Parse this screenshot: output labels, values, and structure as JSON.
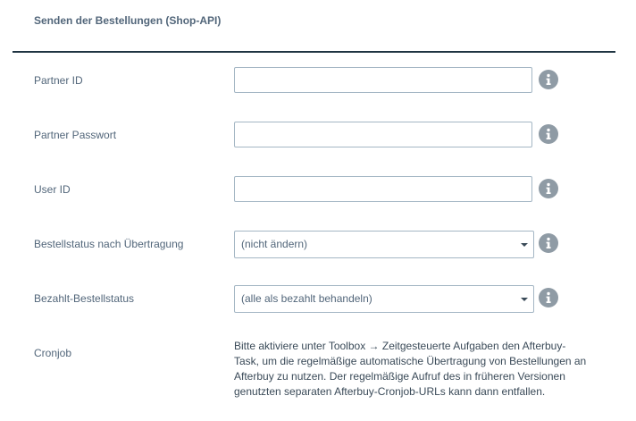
{
  "section": {
    "title": "Senden der Bestellungen (Shop-API)"
  },
  "fields": {
    "partner_id": {
      "label": "Partner ID",
      "value": "",
      "placeholder": ""
    },
    "partner_password": {
      "label": "Partner Passwort",
      "value": "",
      "placeholder": ""
    },
    "user_id": {
      "label": "User ID",
      "value": "",
      "placeholder": ""
    },
    "order_status": {
      "label": "Bestellstatus nach Übertragung",
      "selected": "(nicht ändern)"
    },
    "paid_status": {
      "label": "Bezahlt-Bestellstatus",
      "selected": "(alle als bezahlt behandeln)"
    },
    "cronjob": {
      "label": "Cronjob",
      "text": "Bitte aktiviere unter Toolbox → Zeitgesteuerte Aufgaben den Afterbuy-Task, um die regelmäßige automatische Übertragung von Bestellungen an Afterbuy zu nutzen. Der regelmäßige Aufruf des in früheren Versionen genutzten separaten Afterbuy-Cronjob-URLs kann dann entfallen."
    }
  },
  "icons": {
    "info": "info-icon",
    "dropdown": "chevron-down-icon"
  },
  "colors": {
    "label": "#52667a",
    "divider": "#1f3442",
    "input_border": "#a4b6c4",
    "info_icon": "#8f9ba5"
  }
}
